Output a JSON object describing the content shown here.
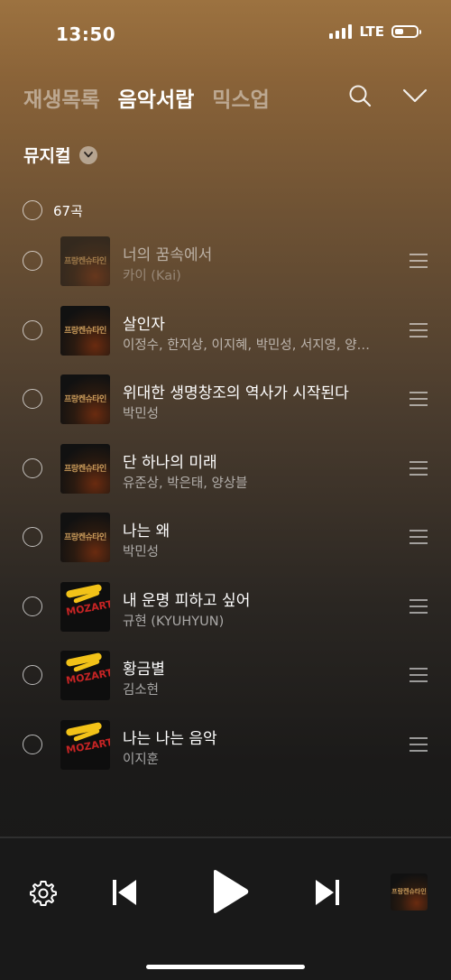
{
  "status_bar": {
    "time": "13:50",
    "network": "LTE"
  },
  "tabs": [
    {
      "label": "재생목록",
      "active": false
    },
    {
      "label": "음악서랍",
      "active": true
    },
    {
      "label": "믹스업",
      "active": false
    }
  ],
  "icons": {
    "search": "search-icon",
    "collapse": "chevron-down-icon"
  },
  "category": {
    "label": "뮤지컬"
  },
  "select_all": {
    "count_label": "67곡"
  },
  "songs": [
    {
      "title": "너의 꿈속에서",
      "artist": "카이 (Kai)",
      "album_art": "프랑켄슈타인"
    },
    {
      "title": "살인자",
      "artist": "이정수, 한지상, 이지혜, 박민성, 서지영, 양…",
      "album_art": "프랑켄슈타인"
    },
    {
      "title": "위대한 생명창조의 역사가 시작된다",
      "artist": "박민성",
      "album_art": "프랑켄슈타인"
    },
    {
      "title": "단 하나의 미래",
      "artist": "유준상, 박은태, 양상블",
      "album_art": "프랑켄슈타인"
    },
    {
      "title": "나는 왜",
      "artist": "박민성",
      "album_art": "프랑켄슈타인"
    },
    {
      "title": "내 운명 피하고 싶어",
      "artist": "규현 (KYUHYUN)",
      "album_art": "MOZART!"
    },
    {
      "title": "황금별",
      "artist": "김소현",
      "album_art": "MOZART!"
    },
    {
      "title": "나는 나는 음악",
      "artist": "이지훈",
      "album_art": "MOZART!"
    }
  ],
  "player": {
    "mini_art": "프랑켄슈타인"
  },
  "colors": {
    "accent_text": "#ffffff",
    "inactive_tab": "#a08a6e",
    "player_bg": "#191919"
  }
}
